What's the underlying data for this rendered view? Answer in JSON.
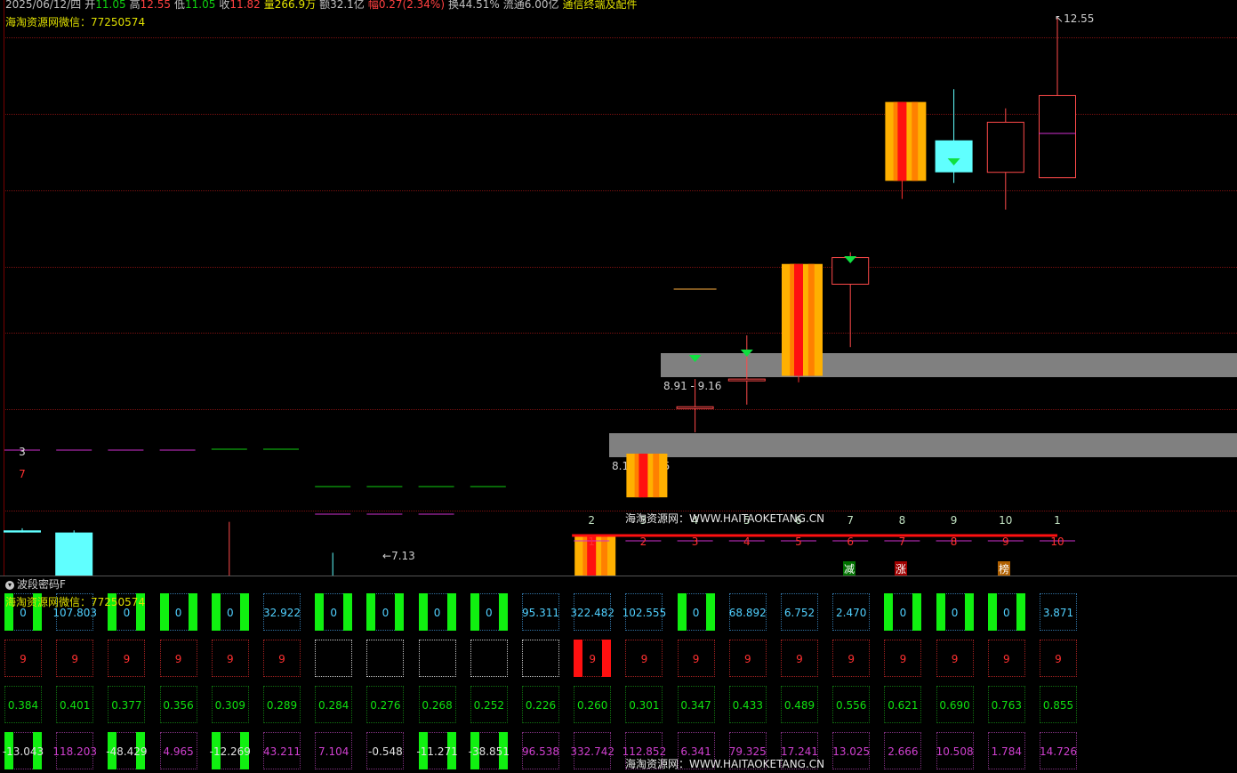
{
  "header": {
    "date": "2025/06/12/四",
    "open_label": "开",
    "open": "11.05",
    "high_label": "高",
    "high": "12.55",
    "low_label": "低",
    "low": "11.05",
    "close_label": "收",
    "close": "11.82",
    "volume": "量266.9万",
    "amount": "额32.1亿",
    "change": "幅0.27(2.34%)",
    "turnover": "换44.51%",
    "float": "流通6.00亿",
    "industry": "通信终端及配件"
  },
  "watermark": {
    "top_left": "海淘资源网微信：77250574",
    "panel_top_left": "海淘资源网微信：77250574",
    "center": "海淘资源网：WWW.HAITAOKETANG.CN",
    "bottom": "海淘资源网：WWW.HAITAOKETANG.CN"
  },
  "price_chart": {
    "high_label": "12.55",
    "low_label": "7.13",
    "zones": [
      {
        "label": "8.91 - 9.16"
      },
      {
        "label": "8.10 - 8.35"
      }
    ],
    "top_count_labels": [
      "3",
      "",
      "",
      "",
      "",
      "",
      "",
      "",
      "",
      "",
      "",
      "2",
      "3",
      "4",
      "5",
      "6",
      "7",
      "8",
      "9",
      "10",
      "1"
    ],
    "bottom_count_labels": [
      "7",
      "",
      "",
      "",
      "",
      "",
      "",
      "",
      "",
      "",
      "",
      "1",
      "2",
      "3",
      "4",
      "5",
      "6",
      "7",
      "8",
      "9",
      "10"
    ],
    "tags": [
      {
        "text": "减",
        "color": "#00c000"
      },
      {
        "text": "涨",
        "color": "#ff3030"
      },
      {
        "text": "榜",
        "color": "#ff9000"
      }
    ]
  },
  "chart_data": {
    "type": "candlestick",
    "title": "",
    "candles": [
      {
        "o": 7.74,
        "h": 7.76,
        "l": 7.72,
        "c": 7.72
      },
      {
        "o": 7.72,
        "h": 7.74,
        "l": 7.25,
        "c": 7.26
      },
      {
        "o": 7.26,
        "h": 7.3,
        "l": 7.22,
        "c": 7.24
      },
      {
        "o": 7.24,
        "h": 7.26,
        "l": 7.2,
        "c": 7.27
      },
      {
        "o": 7.24,
        "h": 7.82,
        "l": 7.23,
        "c": 7.26
      },
      {
        "o": 7.24,
        "h": 7.31,
        "l": 7.17,
        "c": 7.17
      },
      {
        "o": 7.17,
        "h": 7.53,
        "l": 7.06,
        "c": 7.06
      },
      {
        "o": 7.06,
        "h": 7.09,
        "l": 6.93,
        "c": 6.95
      },
      {
        "o": 6.99,
        "h": 7.04,
        "l": 6.95,
        "c": 7.03
      },
      {
        "o": 6.99,
        "h": 7.02,
        "l": 6.96,
        "c": 7.02
      },
      {
        "o": 7.03,
        "h": 7.15,
        "l": 7.03,
        "c": 7.1
      },
      {
        "o": 7.03,
        "h": 7.68,
        "l": 7.02,
        "c": 7.68
      },
      {
        "o": 8.05,
        "h": 8.46,
        "l": 8.05,
        "c": 8.46
      },
      {
        "o": 8.9,
        "h": 9.16,
        "l": 8.66,
        "c": 8.9
      },
      {
        "o": 9.16,
        "h": 9.57,
        "l": 8.92,
        "c": 9.16
      },
      {
        "o": 9.19,
        "h": 10.24,
        "l": 9.13,
        "c": 10.24
      },
      {
        "o": 10.05,
        "h": 10.35,
        "l": 9.46,
        "c": 10.3
      },
      {
        "o": 11.02,
        "h": 11.76,
        "l": 10.85,
        "c": 11.76
      },
      {
        "o": 11.4,
        "h": 11.88,
        "l": 11.0,
        "c": 11.1
      },
      {
        "o": 11.1,
        "h": 11.7,
        "l": 10.75,
        "c": 11.57
      },
      {
        "o": 11.05,
        "h": 12.55,
        "l": 11.05,
        "c": 11.82
      }
    ],
    "limit_up_days": [
      11,
      12,
      15,
      17
    ]
  },
  "panel": {
    "title": "波段密码F",
    "row1": [
      "0",
      "107.803",
      "0",
      "0",
      "0",
      "32.922",
      "0",
      "0",
      "0",
      "0",
      "95.311",
      "322.482",
      "102.555",
      "0",
      "68.892",
      "6.752",
      "2.470",
      "0",
      "0",
      "0",
      "3.871"
    ],
    "row1_green": [
      true,
      false,
      true,
      true,
      true,
      false,
      true,
      true,
      true,
      true,
      false,
      false,
      false,
      true,
      false,
      false,
      false,
      true,
      true,
      true,
      false
    ],
    "row2": [
      "9",
      "9",
      "9",
      "9",
      "9",
      "9",
      "",
      "",
      "",
      "",
      "",
      "9",
      "9",
      "9",
      "9",
      "9",
      "9",
      "9",
      "9",
      "9",
      "9"
    ],
    "row2_red": [
      false,
      false,
      false,
      false,
      false,
      false,
      false,
      false,
      false,
      false,
      false,
      true,
      false,
      false,
      false,
      false,
      false,
      false,
      false,
      false,
      false
    ],
    "row3": [
      "0.384",
      "0.401",
      "0.377",
      "0.356",
      "0.309",
      "0.289",
      "0.284",
      "0.276",
      "0.268",
      "0.252",
      "0.226",
      "0.260",
      "0.301",
      "0.347",
      "0.433",
      "0.489",
      "0.556",
      "0.621",
      "0.690",
      "0.763",
      "0.855"
    ],
    "row4": [
      "-13.043",
      "118.203",
      "-48.429",
      "4.965",
      "-12.269",
      "43.211",
      "7.104",
      "-0.548",
      "-11.271",
      "-38.851",
      "96.538",
      "332.742",
      "112.852",
      "6.341",
      "79.325",
      "17.241",
      "13.025",
      "2.666",
      "10.508",
      "1.784",
      "14.726"
    ],
    "row4_green": [
      true,
      false,
      true,
      false,
      true,
      false,
      false,
      false,
      true,
      true,
      false,
      false,
      false,
      false,
      false,
      false,
      false,
      false,
      false,
      false,
      false
    ]
  }
}
